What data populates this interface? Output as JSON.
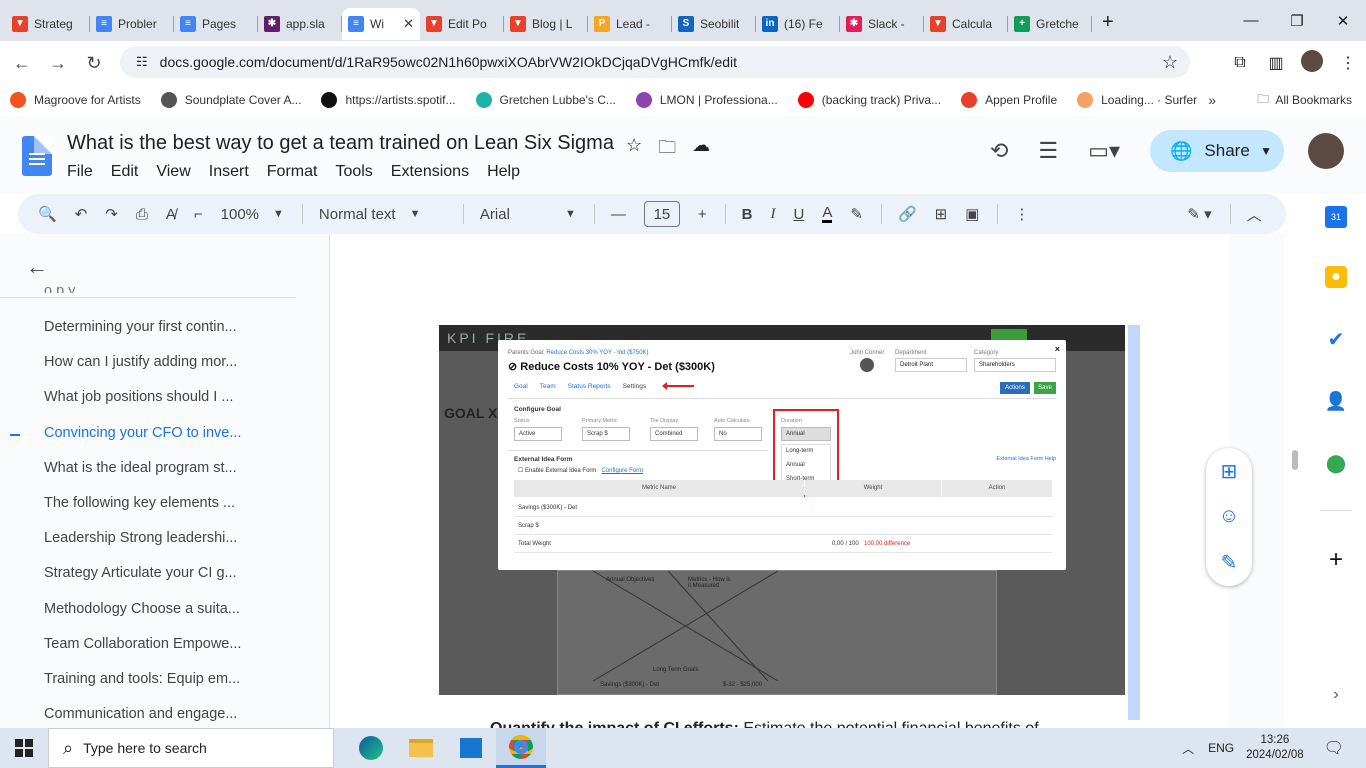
{
  "browser": {
    "tabs": [
      {
        "label": "Strateg",
        "color": "#e8412b",
        "glyph": "▼"
      },
      {
        "label": "Probler",
        "color": "#4285f4",
        "glyph": "≡"
      },
      {
        "label": "Pages",
        "color": "#4285f4",
        "glyph": "≡"
      },
      {
        "label": "app.sla",
        "color": "#611f69",
        "glyph": "✱"
      },
      {
        "label": "Wi",
        "color": "#4285f4",
        "glyph": "≡",
        "active": true
      },
      {
        "label": "Edit Po",
        "color": "#e8412b",
        "glyph": "▼"
      },
      {
        "label": "Blog | L",
        "color": "#e8412b",
        "glyph": "▼"
      },
      {
        "label": "Lead -",
        "color": "#f5a623",
        "glyph": "P"
      },
      {
        "label": "Seobilit",
        "color": "#1565c0",
        "glyph": "S"
      },
      {
        "label": "(16) Fe",
        "color": "#0a66c2",
        "glyph": "in"
      },
      {
        "label": "Slack -",
        "color": "#e01e5a",
        "glyph": "✱"
      },
      {
        "label": "Calcula",
        "color": "#e8412b",
        "glyph": "▼"
      },
      {
        "label": "Gretche",
        "color": "#0f9d58",
        "glyph": "+"
      }
    ],
    "close_glyph": "✕",
    "new_tab_glyph": "+",
    "url": "docs.google.com/document/d/1RaR95owc02N1h60pwxiXOAbrVW2IOkDCjqaDVgHCmfk/edit",
    "bookmarks": [
      {
        "label": "Magroove for Artists",
        "color": "#f4511e"
      },
      {
        "label": "Soundplate Cover A...",
        "color": "#555555"
      },
      {
        "label": "https://artists.spotif...",
        "color": "#111111"
      },
      {
        "label": "Gretchen Lubbe's C...",
        "color": "#20b2aa"
      },
      {
        "label": "LMON | Professiona...",
        "color": "#8e44ad"
      },
      {
        "label": "(backing track) Priva...",
        "color": "#ff0000"
      },
      {
        "label": "Appen Profile",
        "color": "#e8412b"
      },
      {
        "label": "Loading... · Surfer",
        "color": "#f4a261"
      }
    ],
    "more_bookmarks": "»",
    "all_bookmarks": "All Bookmarks"
  },
  "doc": {
    "title": "What is the best way to get a team trained on Lean Six Sigma",
    "menus": [
      "File",
      "Edit",
      "View",
      "Insert",
      "Format",
      "Tools",
      "Extensions",
      "Help"
    ],
    "share_label": "Share",
    "toolbar": {
      "zoom": "100%",
      "style": "Normal text",
      "font": "Arial",
      "font_size": "15"
    },
    "outline": [
      {
        "label": "Determining your first contin...",
        "active": false
      },
      {
        "label": "How can I justify adding mor...",
        "active": false
      },
      {
        "label": "What job positions should I ...",
        "active": false
      },
      {
        "label": "Convincing your CFO to inve...",
        "active": true
      },
      {
        "label": "What is the ideal program st...",
        "active": false
      },
      {
        "label": "The following key elements ...",
        "active": false
      },
      {
        "label": "Leadership Strong leadershi...",
        "active": false
      },
      {
        "label": "Strategy Articulate your CI g...",
        "active": false
      },
      {
        "label": "Methodology Choose a suita...",
        "active": false
      },
      {
        "label": "Team Collaboration Empowe...",
        "active": false
      },
      {
        "label": "Training and tools: Equip em...",
        "active": false
      },
      {
        "label": "Communication and engage...",
        "active": false
      }
    ],
    "bottom_text_bold": "Quantify the impact of CI efforts:",
    "bottom_text": " Estimate the potential financial benefits of"
  },
  "embedded": {
    "logo": "KPI FIRE",
    "goal_header": "GOAL X",
    "parent_goal_label": "Parents Goal:",
    "parent_goal": "Reduce Costs 30% YOY - Ind ($750K)",
    "title": "Reduce Costs 10% YOY - Det ($300K)",
    "owner": "John Conner",
    "department_label": "Department",
    "department": "Detroit Plant",
    "category_label": "Category",
    "category": "Shareholders",
    "tabs": [
      "Goal",
      "Team",
      "Status Reports",
      "Settings"
    ],
    "actions": "Actions",
    "save": "Save",
    "configure_goal": "Configure Goal",
    "fields": [
      {
        "label": "Status",
        "value": "Active"
      },
      {
        "label": "Primary Metric",
        "value": "Scrap $"
      },
      {
        "label": "Tile Display",
        "value": "Combined"
      },
      {
        "label": "Auto Calculate",
        "value": "No"
      },
      {
        "label": "Duration",
        "value": "Annual"
      }
    ],
    "duration_options": [
      "Long-term",
      "Annual",
      "Short-term"
    ],
    "external_form": "External Idea Form",
    "enable_external": "Enable External Idea Form",
    "configure_form": "Configure Form",
    "external_help": "External Idea Form Help",
    "table_headers": [
      "Metric Name",
      "Weight",
      "Action"
    ],
    "rows": [
      "Savings ($300K) - Det",
      "Scrap $",
      "Total Weight"
    ],
    "total_weight": "0.00 / 100",
    "difference": "100.00 difference",
    "lower_labels": {
      "annual": "Annual Objectives",
      "metrics": "Metrics - How is it Measured",
      "long_term": "Long Term Goals",
      "bottom": "Savings ($300K) - Det",
      "bottom_value": "$-32 - $25,000"
    }
  },
  "taskbar": {
    "search_placeholder": "Type here to search",
    "lang": "ENG",
    "time": "13:26",
    "date": "2024/02/08"
  }
}
